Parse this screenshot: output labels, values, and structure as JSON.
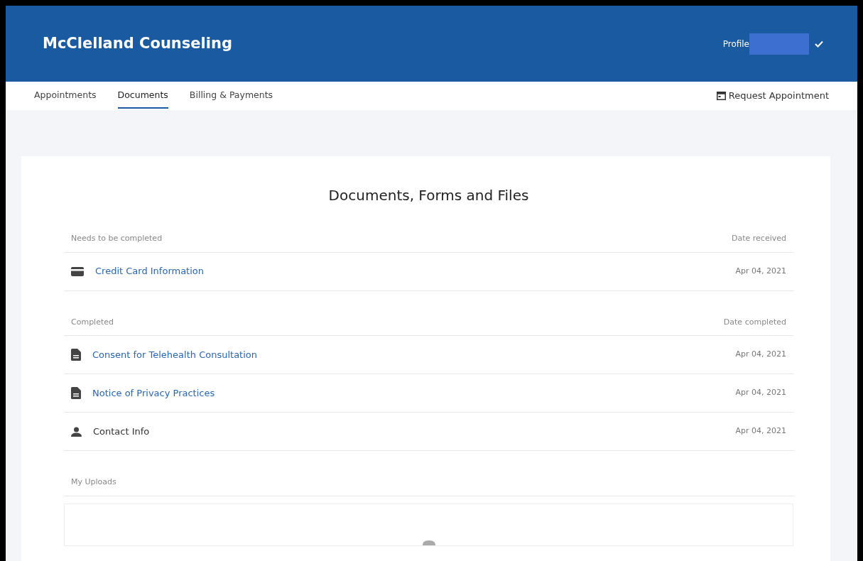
{
  "header": {
    "brand": "McClelland Counseling",
    "profile_label": "Profile"
  },
  "tabs": [
    {
      "label": "Appointments",
      "selected": false
    },
    {
      "label": "Documents",
      "selected": true
    },
    {
      "label": "Billing & Payments",
      "selected": false
    }
  ],
  "request_button": "Request Appointment",
  "page_title": "Documents, Forms and Files",
  "sections": [
    {
      "heading": "Needs to be completed",
      "date_heading": "Date received",
      "rows": [
        {
          "kind": "card",
          "label": "Credit Card Information",
          "link": true,
          "date": "Apr 04, 2021"
        }
      ]
    },
    {
      "heading": "Completed",
      "date_heading": "Date completed",
      "rows": [
        {
          "kind": "document",
          "label": "Consent for Telehealth Consultation",
          "link": true,
          "date": "Apr 04, 2021"
        },
        {
          "kind": "document",
          "label": "Notice of Privacy Practices",
          "link": true,
          "date": "Apr 04, 2021"
        },
        {
          "kind": "person",
          "label": "Contact Info",
          "link": false,
          "date": "Apr 04, 2021"
        }
      ]
    }
  ],
  "uploads_heading": "My Uploads"
}
